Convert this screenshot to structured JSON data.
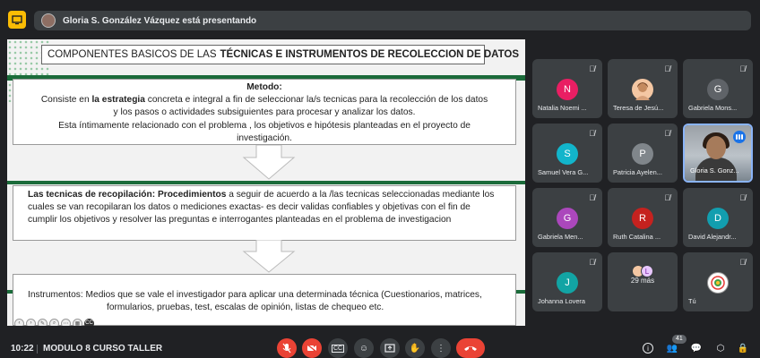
{
  "presenter": {
    "text": "Gloria S. González Vázquez está presentando"
  },
  "slide": {
    "title_plain": "COMPONENTES BASICOS DE LAS",
    "title_bold": "TÉCNICAS  E INSTRUMENTOS DE RECOLECCION DE DATOS",
    "box1": {
      "heading": "Metodo:",
      "line1_pre": "Consiste  en",
      "line1_bold": "la  estrategia",
      "line1_post": " concreta e integral   a fin de  seleccionar  la/s tecnicas para la recolección de los datos",
      "line2": "y los pasos o actividades subsiguientes para procesar y analizar los datos.",
      "line3": "Esta íntimamente relacionado con el problema , los objetivos e hipótesis planteadas en el proyecto de",
      "line4": "investigación."
    },
    "box2": {
      "bold": "Las tecnicas de recopilación: Procedimientos",
      "line1_post": " a seguir de acuerdo a la /las tecnicas seleccionadas  mediante los",
      "line2": "cuales se  van recopilaran los  datos o mediciones exactas- es decir validas confiables y objetivas con el fin de",
      "line3": "cumplir los objetivos y  resolver las preguntas e interrogantes planteadas en el problema de investigacion"
    },
    "box3": {
      "line1": "Instrumentos: Medios  que se vale el investigador para aplicar una determinada técnica (Cuestionarios, matrices,",
      "line2": "formularios, pruebas, test, escalas de opinión, listas de chequeo etc."
    }
  },
  "participants": [
    {
      "initial": "N",
      "name": "Natalia Noemi ...",
      "color": "#e91e63"
    },
    {
      "initial": "",
      "name": "Teresa de Jesú...",
      "color": "#f4c7a3"
    },
    {
      "initial": "G",
      "name": "Gabriela Mons...",
      "color": "#5f6368"
    },
    {
      "initial": "S",
      "name": "Samuel Vera G...",
      "color": "#12b5cb"
    },
    {
      "initial": "P",
      "name": "Patricia Ayelen...",
      "color": "#80868b"
    },
    {
      "initial": "",
      "name": "Gloria S. Gonz...",
      "color": "#000000"
    },
    {
      "initial": "G",
      "name": "Gabriela Men...",
      "color": "#ab47bc"
    },
    {
      "initial": "R",
      "name": "Ruth Catalina ...",
      "color": "#c5221f"
    },
    {
      "initial": "D",
      "name": "David Alejandr...",
      "color": "#129eaf"
    },
    {
      "initial": "J",
      "name": "Johanna Lovera",
      "color": "#12a4a4"
    },
    {
      "initial": "L",
      "name": "29 más",
      "color": "#e8c7ff"
    },
    {
      "initial": "",
      "name": "Tú",
      "color": "#ffffff"
    }
  ],
  "bottom": {
    "time": "10:22",
    "meeting": "MODULO 8 CURSO TALLER",
    "participant_count": "41"
  },
  "colors": {
    "accent_green": "#1b6b3a",
    "end_call": "#ea4335",
    "tile_bg": "#3c4043"
  }
}
